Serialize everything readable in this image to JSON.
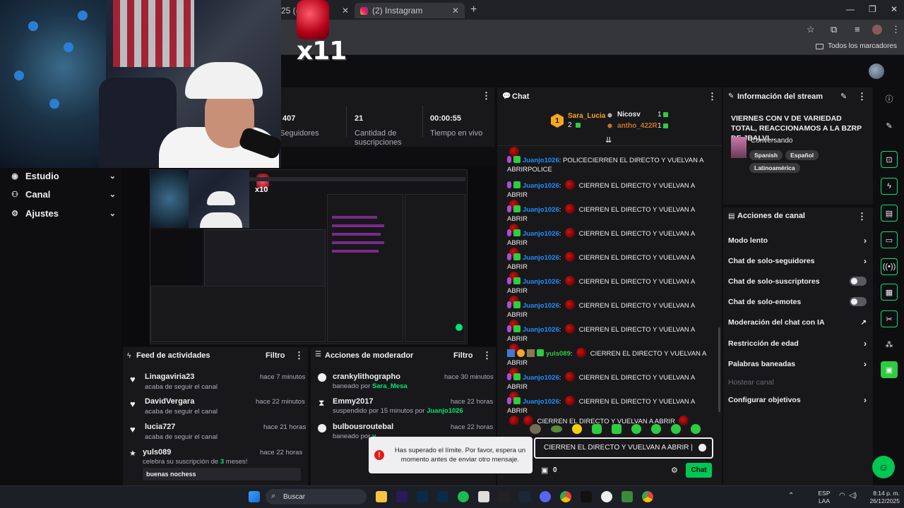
{
  "browser": {
    "tab1_label": "25 (@",
    "tab2_label": "(2) Instagram",
    "new_tab": "+",
    "bookmarks_all": "Todos los marcadores"
  },
  "webcam": {
    "alert_text": "x11"
  },
  "sidebar": {
    "items": [
      {
        "label": "Estudio",
        "icon": "studio-icon"
      },
      {
        "label": "Canal",
        "icon": "channel-icon"
      },
      {
        "label": "Ajustes",
        "icon": "gear-icon"
      }
    ]
  },
  "stats": {
    "followers_value": "407",
    "followers_label": "Seguidores",
    "subs_value": "21",
    "subs_label": "Cantidad de suscripciones",
    "live_value": "00:00:55",
    "live_label": "Tiempo en vivo"
  },
  "preview": {
    "alert_text": "x10"
  },
  "activity": {
    "title": "Feed de actividades",
    "filter": "Filtro",
    "items": [
      {
        "name": "Linagaviria23",
        "sub": "acaba de seguir el canal",
        "time": "hace 7 minutos"
      },
      {
        "name": "DavidVergara",
        "sub": "acaba de seguir el canal",
        "time": "hace 22 minutos"
      },
      {
        "name": "lucia727",
        "sub": "acaba de seguir el canal",
        "time": "hace 21 horas"
      },
      {
        "name": "yuls089",
        "sub_pre": "celebra su suscripción de ",
        "sub_num": "3",
        "sub_post": " meses!",
        "time": "hace 22 horas",
        "message": "buenas nochess"
      }
    ]
  },
  "mod": {
    "title": "Acciones de moderador",
    "filter": "Filtro",
    "items": [
      {
        "name": "crankylithographo",
        "sub_pre": "baneado por ",
        "by": "Sara_Mesa",
        "time": "hace 30 minutos"
      },
      {
        "name": "Emmy2017",
        "sub_pre": "suspendido por 15 minutos por ",
        "by": "Juanjo1026",
        "time": "hace 22 horas"
      },
      {
        "name": "bulbousroutebal",
        "sub_pre": "baneado por ",
        "by": "v",
        "time": "hace 22 horas"
      }
    ]
  },
  "chat": {
    "title": "Chat",
    "leaders": [
      {
        "name": "Sara_Lucia",
        "count": "2"
      },
      {
        "name": "Nicosv",
        "count": "1"
      },
      {
        "name": "antho_422R",
        "count": "1"
      }
    ],
    "rank": "1",
    "first_msg_user": "Juanjo1026",
    "first_msg_text": "POLICECIERREN EL DIRECTO Y VUELVAN A ABRIRPOLICE",
    "repeat_user": "Juanjo1026",
    "repeat_text": "CIERREN EL DIRECTO Y VUELVAN A ABRIR",
    "yuls_user": "yuls089",
    "yuls_text": "CIERREN EL DIRECTO Y VUELVAN A ABRIR",
    "tail_text": "CIERREN EL DIRECTO Y VUELVAN A ABRIR",
    "input_value": "CIERREN EL DIRECTO Y VUELVAN A ABRIR",
    "points": "0",
    "send_label": "Chat"
  },
  "toast": {
    "text": "Has superado el límite. Por favor, espera un momento antes de enviar otro mensaje."
  },
  "info": {
    "title": "Información del stream",
    "stream_title": "VIERNES CON V DE VARIEDAD TOTAL, REACCIONAMOS A LA BZRP DE JBALVI...",
    "category": "Conversando",
    "tags": [
      "Spanish",
      "Español",
      "Latinoamérica"
    ]
  },
  "actions": {
    "title": "Acciones de canal",
    "rows": [
      {
        "label": "Modo lento",
        "kind": "chevron"
      },
      {
        "label": "Chat de solo-seguidores",
        "kind": "chevron"
      },
      {
        "label": "Chat de solo-suscriptores",
        "kind": "toggle"
      },
      {
        "label": "Chat de solo-emotes",
        "kind": "toggle"
      },
      {
        "label": "Moderación del chat con IA",
        "kind": "external"
      },
      {
        "label": "Restricción de edad",
        "kind": "chevron"
      },
      {
        "label": "Palabras baneadas",
        "kind": "chevron"
      },
      {
        "label": "Hostear canal",
        "kind": "disabled"
      },
      {
        "label": "Configurar objetivos",
        "kind": "chevron"
      }
    ]
  },
  "taskbar": {
    "search_placeholder": "Buscar",
    "lang_top": "ESP",
    "lang_bottom": "LAA",
    "time": "8:14 p. m.",
    "date": "26/12/2025"
  },
  "colors": {
    "accent": "#00e676",
    "link": "#1e90ff",
    "bg": "#0e0e10",
    "panel": "#18181b"
  }
}
